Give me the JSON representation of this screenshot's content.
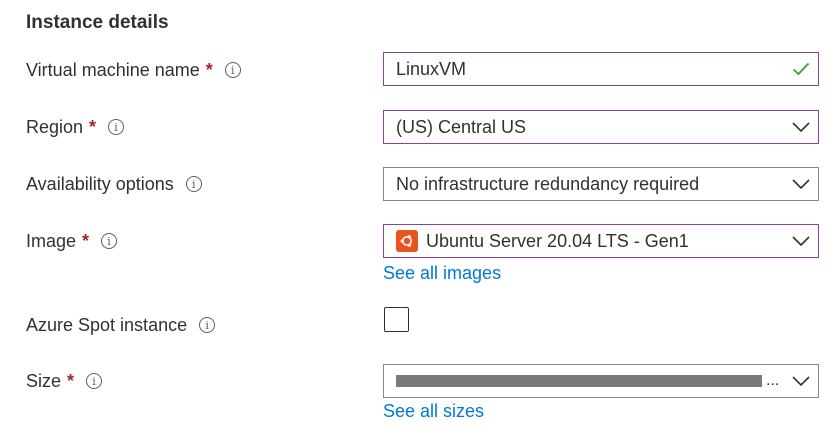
{
  "section": {
    "title": "Instance details"
  },
  "vm_name": {
    "label": "Virtual machine name",
    "required_mark": "*",
    "value": "LinuxVM"
  },
  "region": {
    "label": "Region",
    "required_mark": "*",
    "value": "(US) Central US"
  },
  "availability": {
    "label": "Availability options",
    "value": "No infrastructure redundancy required"
  },
  "image": {
    "label": "Image",
    "required_mark": "*",
    "value": "Ubuntu Server 20.04 LTS - Gen1",
    "link": "See all images",
    "logo_icon": "ubuntu-logo-icon"
  },
  "spot": {
    "label": "Azure Spot instance",
    "checked": false
  },
  "size": {
    "label": "Size",
    "required_mark": "*",
    "value_truncation": "...",
    "link": "See all sizes"
  },
  "colors": {
    "required": "#a4262c",
    "active_border": "#8c3fa8",
    "link": "#0078d4",
    "valid_check": "#2e9e3a",
    "ubuntu": "#e95420"
  }
}
